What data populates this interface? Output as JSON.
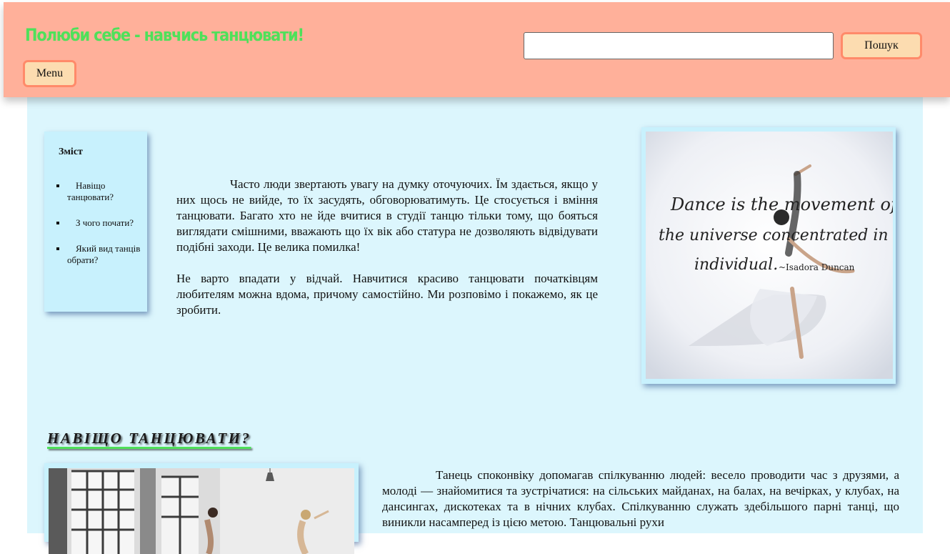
{
  "header": {
    "title": "Полюби себе - навчись танцювати!",
    "menu_label": "Menu",
    "search": {
      "value": "",
      "placeholder": ""
    },
    "search_button_label": "Пошук"
  },
  "toc": {
    "title": "Зміст",
    "items": [
      {
        "label": "Навіщо танцювати?"
      },
      {
        "label": "З чого почати?"
      },
      {
        "label": "Який вид танців обрати?"
      }
    ]
  },
  "intro": {
    "p1": "Часто люди звертають увагу на думку оточуючих. Їм здається, якщо у них щось не вийде, то їх засудять, обговорюватимуть. Це стосується і вміння танцювати. Багато хто не йде вчитися в студії танцю тільки тому, що бояться виглядати смішними, вважають що їх вік або статура не дозволяють відвідувати подібні заходи. Це велика помилка!",
    "p2": "Не варто впадати у відчай. Навчитися красиво танцювати початківцям любителям можна вдома, причому самостійно. Ми розповімо і покажемо, як це зробити."
  },
  "quote_image": {
    "line1": "Dance is the movement of",
    "line2": "the universe concentrated in an",
    "line3": "individual.",
    "author": "~Isadora Duncan"
  },
  "section": {
    "heading": "НАВІЩО ТАНЦЮВАТИ?",
    "text": "Танець споконвіку допомагав спілкуванню людей: весело проводити час з друзями, а молоді — знайомитися та зустрічатися: на сільських майданах, на балах, на вечірках, у клубах, на дансингах, дискотеках та в нічних клубах. Спілкуванню служать здебільшого парні танці, що виникли насамперед із цією метою. Танцювальні рухи"
  }
}
